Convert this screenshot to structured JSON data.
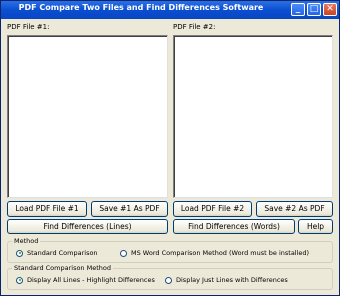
{
  "window": {
    "title": "PDF Compare Two Files and Find Differences Software",
    "minimize_glyph": "_",
    "maximize_glyph": "□",
    "close_glyph": "✕"
  },
  "pdf1": {
    "label": "PDF File #1:"
  },
  "pdf2": {
    "label": "PDF File #2:"
  },
  "buttons": {
    "load1": "Load PDF File #1",
    "save1": "Save #1 As PDF",
    "load2": "Load PDF File #2",
    "save2": "Save #2 As PDF",
    "find_lines": "Find Differences (Lines)",
    "find_words": "Find Differences (Words)",
    "help": "Help"
  },
  "method": {
    "label": "Method",
    "options": [
      {
        "label": "Standard Comparison",
        "selected": true
      },
      {
        "label": "MS Word Comparison Method (Word must be installed)",
        "selected": false
      }
    ]
  },
  "standard_method": {
    "label": "Standard Comparison Method",
    "options": [
      {
        "label": "Display All Lines - Highlight Differences",
        "selected": true
      },
      {
        "label": "Display Just Lines with Differences",
        "selected": false
      }
    ]
  }
}
